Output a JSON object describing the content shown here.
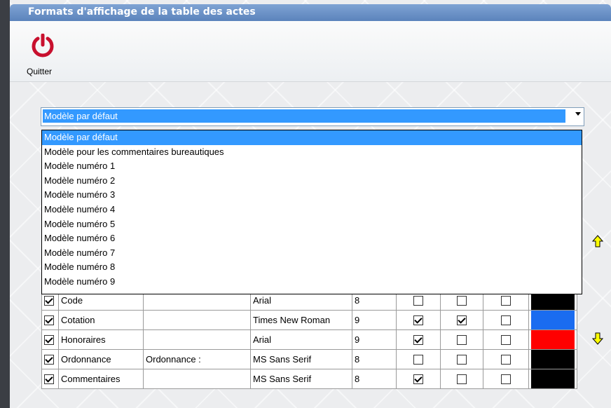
{
  "window": {
    "title": "Formats d'affichage de la table des actes"
  },
  "toolbar": {
    "quit_label": "Quitter"
  },
  "model_select": {
    "selected": "Modèle par défaut",
    "options": [
      "Modèle par défaut",
      "Modèle pour les commentaires bureautiques",
      "Modèle numéro 1",
      "Modèle numéro 2",
      "Modèle numéro 3",
      "Modèle numéro 4",
      "Modèle numéro 5",
      "Modèle numéro 6",
      "Modèle numéro 7",
      "Modèle numéro 8",
      "Modèle numéro 9"
    ]
  },
  "rows": [
    {
      "checked": true,
      "name": "Code",
      "label": "",
      "font": "Arial",
      "size": "8",
      "bold": false,
      "italic": false,
      "underline": false,
      "color": "#000000"
    },
    {
      "checked": true,
      "name": "Cotation",
      "label": "",
      "font": "Times New Roman",
      "size": "9",
      "bold": true,
      "italic": true,
      "underline": false,
      "color": "#1a6cf0"
    },
    {
      "checked": true,
      "name": "Honoraires",
      "label": "",
      "font": "Arial",
      "size": "9",
      "bold": true,
      "italic": false,
      "underline": false,
      "color": "#ff0000"
    },
    {
      "checked": true,
      "name": "Ordonnance",
      "label": "Ordonnance :",
      "font": "MS Sans Serif",
      "size": "8",
      "bold": false,
      "italic": false,
      "underline": false,
      "color": "#000000"
    },
    {
      "checked": true,
      "name": "Commentaires",
      "label": "",
      "font": "MS Sans Serif",
      "size": "8",
      "bold": true,
      "italic": false,
      "underline": false,
      "color": "#000000"
    }
  ],
  "colors": {
    "accent": "#3399ff",
    "title_bar": "#6a90c6",
    "quit_icon": "#c8102e",
    "arrow_icon": "#ffff00"
  }
}
